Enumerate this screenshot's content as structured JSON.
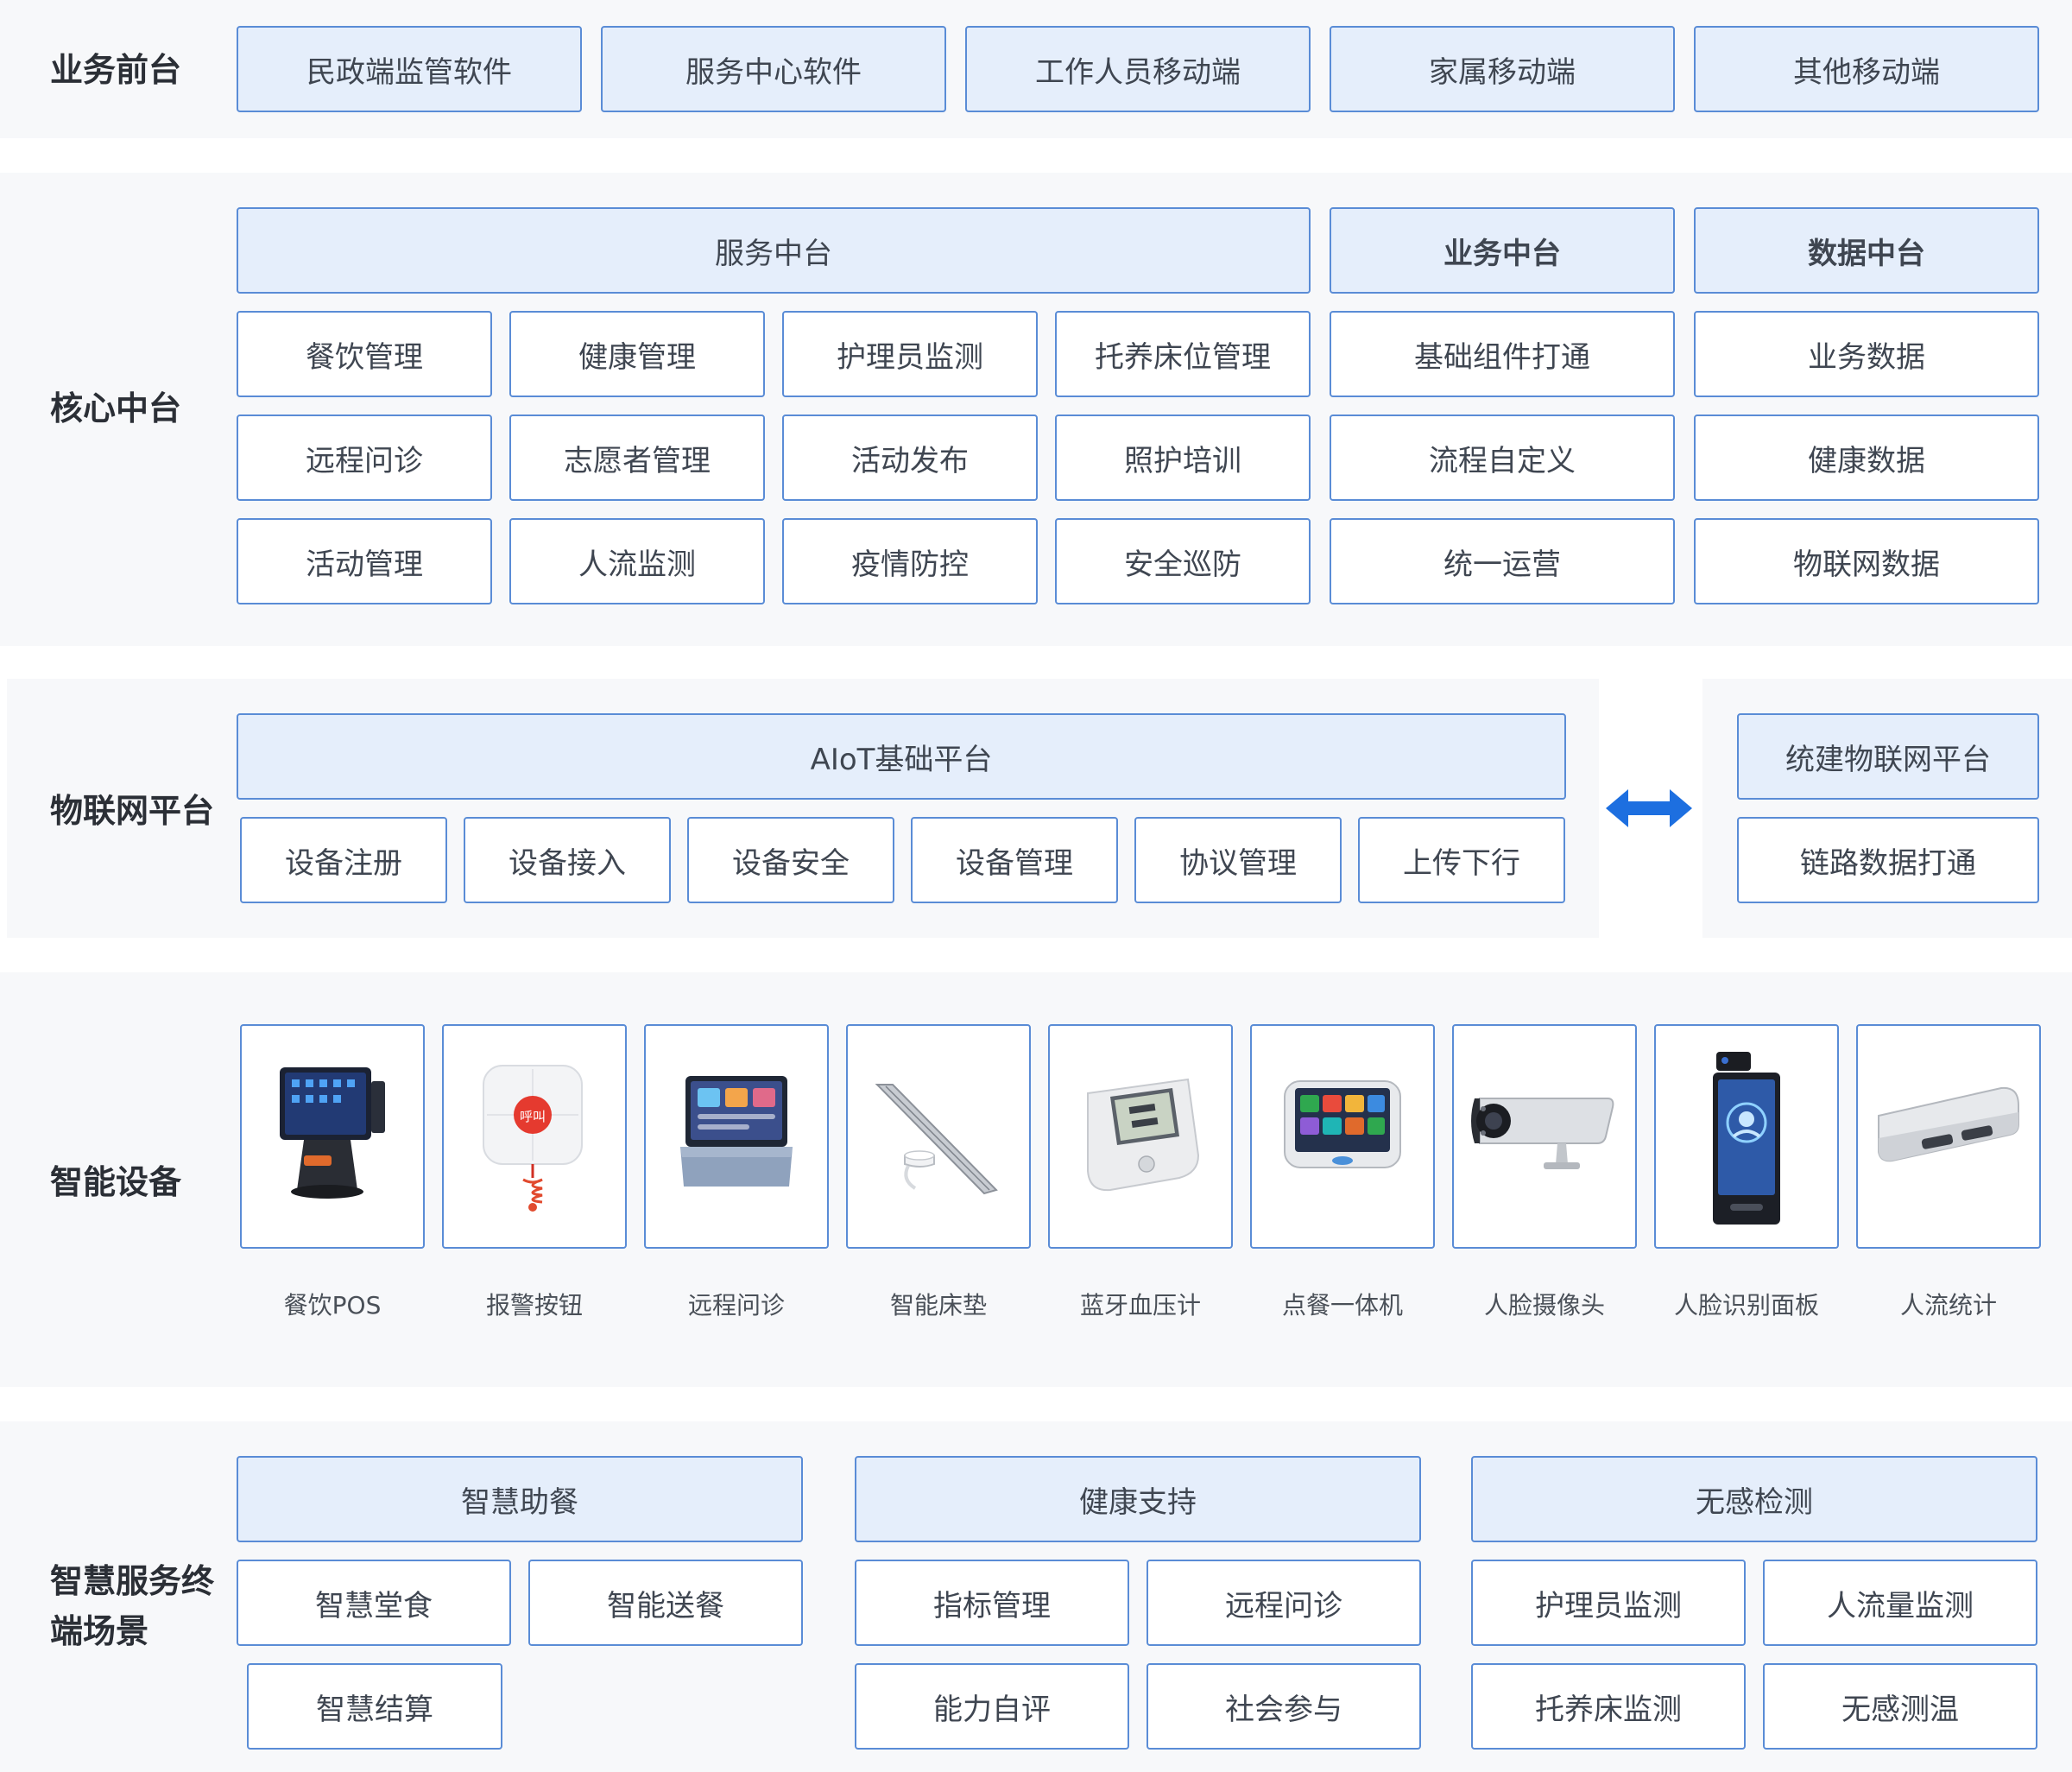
{
  "frontend": {
    "label": "业务前台",
    "items": [
      "民政端监管软件",
      "服务中心软件",
      "工作人员移动端",
      "家属移动端",
      "其他移动端"
    ]
  },
  "core": {
    "label": "核心中台",
    "service_header": "服务中台",
    "business_header": "业务中台",
    "data_header": "数据中台",
    "service_items": [
      "餐饮管理",
      "健康管理",
      "护理员监测",
      "托养床位管理",
      "远程问诊",
      "志愿者管理",
      "活动发布",
      "照护培训",
      "活动管理",
      "人流监测",
      "疫情防控",
      "安全巡防"
    ],
    "business_items": [
      "基础组件打通",
      "流程自定义",
      "统一运营"
    ],
    "data_items": [
      "业务数据",
      "健康数据",
      "物联网数据"
    ]
  },
  "iot": {
    "label": "物联网平台",
    "aiot_header": "AIoT基础平台",
    "aiot_items": [
      "设备注册",
      "设备接入",
      "设备安全",
      "设备管理",
      "协议管理",
      "上传下行"
    ],
    "unified_header": "统建物联网平台",
    "unified_item": "链路数据打通",
    "arrow": "double-arrow-icon"
  },
  "devices": {
    "label": "智能设备",
    "items": [
      {
        "name": "餐饮POS",
        "icon": "pos-terminal-icon"
      },
      {
        "name": "报警按钮",
        "icon": "alarm-button-icon",
        "badge": "呼叫"
      },
      {
        "name": "远程问诊",
        "icon": "consult-screen-icon"
      },
      {
        "name": "智能床垫",
        "icon": "mattress-sensor-icon"
      },
      {
        "name": "蓝牙血压计",
        "icon": "blood-pressure-meter-icon"
      },
      {
        "name": "点餐一体机",
        "icon": "ordering-tablet-icon"
      },
      {
        "name": "人脸摄像头",
        "icon": "face-camera-icon"
      },
      {
        "name": "人脸识别面板",
        "icon": "face-panel-icon"
      },
      {
        "name": "人流统计",
        "icon": "people-counter-icon"
      }
    ]
  },
  "scenes": {
    "label": "智慧服务终\n端场景",
    "groups": [
      {
        "header": "智慧助餐",
        "items": [
          "智慧堂食",
          "智能送餐",
          "智慧结算"
        ]
      },
      {
        "header": "健康支持",
        "items": [
          "指标管理",
          "远程问诊",
          "能力自评",
          "社会参与"
        ]
      },
      {
        "header": "无感检测",
        "items": [
          "护理员监测",
          "人流量监测",
          "托养床监测",
          "无感测温"
        ]
      }
    ]
  },
  "colors": {
    "border": "#5a8cd6",
    "header_fill": "#e5eefb",
    "band": "#f7f8fa",
    "arrow": "#1d6fe0"
  }
}
